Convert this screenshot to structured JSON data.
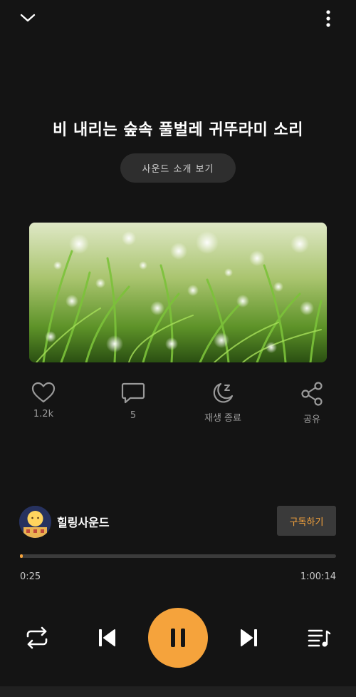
{
  "track": {
    "title": "비 내리는 숲속 풀벌레 귀뚜라미 소리",
    "intro_label": "사운드 소개 보기"
  },
  "actions": [
    {
      "name": "like",
      "icon": "heart-icon",
      "label": "1.2k"
    },
    {
      "name": "comments",
      "icon": "comment-icon",
      "label": "5"
    },
    {
      "name": "sleep-timer",
      "icon": "moon-sleep-icon",
      "label": "재생 종료"
    },
    {
      "name": "share",
      "icon": "share-icon",
      "label": "공유"
    }
  ],
  "channel": {
    "name": "힐링사운드",
    "subscribe_label": "구독하기"
  },
  "playback": {
    "current_time": "0:25",
    "total_time": "1:00:14",
    "progress_fraction": 0.007,
    "state": "playing"
  },
  "colors": {
    "accent": "#f5a33c",
    "background": "#141414",
    "muted_text": "#9a9a9a"
  }
}
